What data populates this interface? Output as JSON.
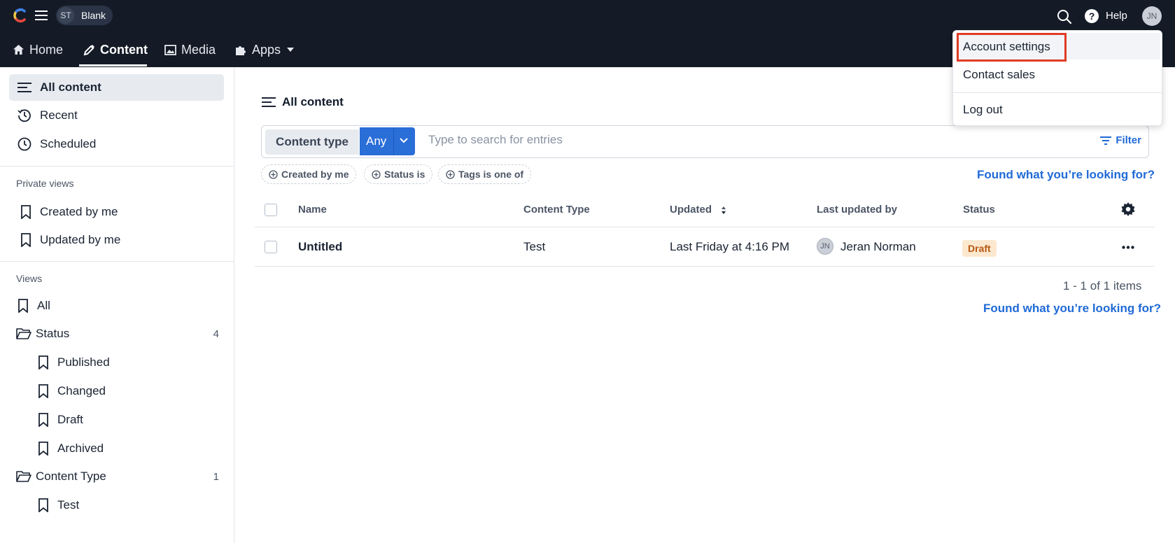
{
  "topbar": {
    "space_initials": "ST",
    "space_name": "Blank",
    "help_label": "Help",
    "user_initials": "JN"
  },
  "nav": {
    "tabs": [
      {
        "label": "Home",
        "icon": "home-icon"
      },
      {
        "label": "Content",
        "icon": "pen-icon",
        "active": true
      },
      {
        "label": "Media",
        "icon": "image-icon"
      },
      {
        "label": "Apps",
        "icon": "puzzle-icon"
      }
    ]
  },
  "sidebar": {
    "all_content": "All content",
    "recent": "Recent",
    "scheduled": "Scheduled",
    "private_views_heading": "Private views",
    "created_by_me": "Created by me",
    "updated_by_me": "Updated by me",
    "views_heading": "Views",
    "all": "All",
    "status_folder": "Status",
    "status_count": "4",
    "published": "Published",
    "changed": "Changed",
    "draft": "Draft",
    "archived": "Archived",
    "content_type_folder": "Content Type",
    "content_type_count": "1",
    "test": "Test"
  },
  "main": {
    "title": "All content",
    "content_type_label": "Content type",
    "content_type_value": "Any",
    "search_placeholder": "Type to search for entries",
    "filter_label": "Filter",
    "chips": [
      "Created by me",
      "Status is",
      "Tags is one of"
    ],
    "found_link": "Found what you’re looking for?"
  },
  "table": {
    "headers": {
      "name": "Name",
      "content_type": "Content Type",
      "updated": "Updated",
      "last_updated_by": "Last updated by",
      "status": "Status"
    },
    "rows": [
      {
        "name": "Untitled",
        "content_type": "Test",
        "updated": "Last Friday at 4:16 PM",
        "user_initials": "JN",
        "last_updated_by": "Jeran Norman",
        "status": "Draft"
      }
    ],
    "pagination": "1 - 1 of 1 items"
  },
  "account_menu": {
    "items": [
      "Account settings",
      "Contact sales",
      "Log out"
    ]
  },
  "colors": {
    "topbar_bg": "#141b27",
    "accent_blue": "#2a6ed8",
    "link_blue": "#1f6ad6",
    "draft_badge_bg": "#fce8cf",
    "draft_badge_text": "#b5570f",
    "highlight_red": "#e03c25"
  }
}
